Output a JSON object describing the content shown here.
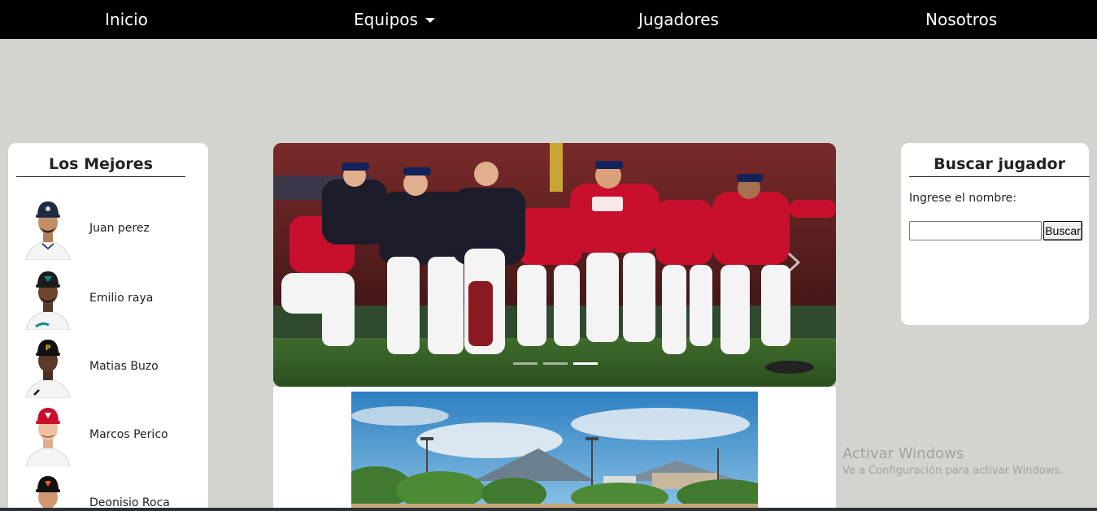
{
  "nav": {
    "items": [
      {
        "label": "Inicio"
      },
      {
        "label": "Equipos",
        "has_dropdown": true
      },
      {
        "label": "Jugadores"
      },
      {
        "label": "Nosotros"
      }
    ]
  },
  "best_players": {
    "title": "Los Mejores",
    "players": [
      {
        "name": "Juan perez"
      },
      {
        "name": "Emilio raya"
      },
      {
        "name": "Matias Buzo"
      },
      {
        "name": "Marcos Perico"
      },
      {
        "name": "Deonisio Roca"
      }
    ]
  },
  "carousel": {
    "slide_count": 3,
    "active_index": 2
  },
  "search": {
    "title": "Buscar jugador",
    "label": "Ingrese el nombre:",
    "input_value": "",
    "button_label": "Buscar"
  },
  "watermark": {
    "title": "Activar Windows",
    "subtitle": "Ve a Configuración para activar Windows."
  },
  "colors": {
    "background": "#d3d4cf",
    "nav_background": "#000000",
    "card_background": "#ffffff",
    "team_red": "#c8102e",
    "team_navy": "#14225a"
  }
}
